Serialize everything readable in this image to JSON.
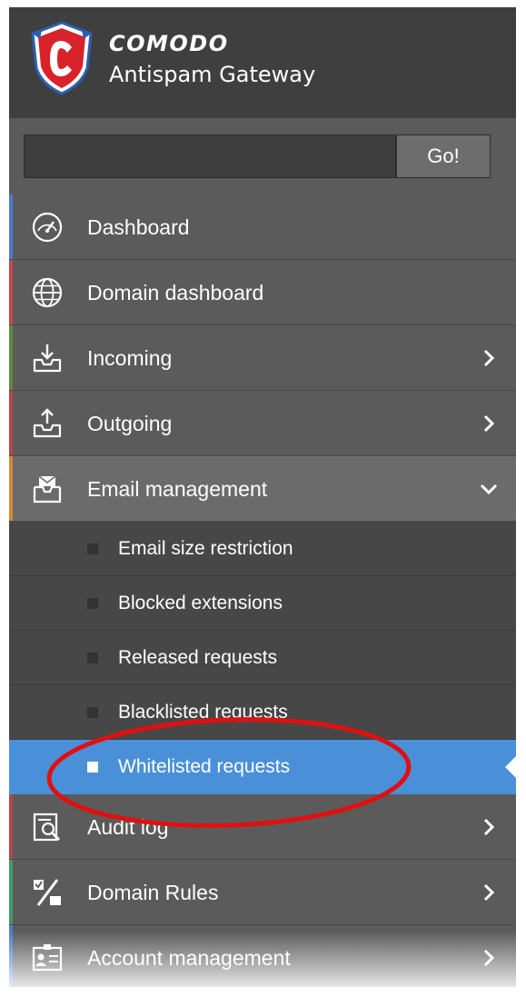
{
  "brand": {
    "name": "COMODO",
    "product": "Antispam Gateway"
  },
  "search": {
    "value": "",
    "go_label": "Go!"
  },
  "nav": {
    "items": [
      {
        "label": "Dashboard",
        "icon": "speedometer-icon",
        "stripe": "#4a7bd0"
      },
      {
        "label": "Domain dashboard",
        "icon": "globe-icon",
        "stripe": "#c9434d"
      },
      {
        "label": "Incoming",
        "icon": "inbox-download-icon",
        "stripe": "#5f8a3c"
      },
      {
        "label": "Outgoing",
        "icon": "inbox-upload-icon",
        "stripe": "#b8434b"
      },
      {
        "label": "Email management",
        "icon": "email-tray-icon",
        "stripe": "#d28b2f"
      },
      {
        "label": "Audit log",
        "icon": "audit-search-icon",
        "stripe": "#b8434b"
      },
      {
        "label": "Domain Rules",
        "icon": "domain-rules-icon",
        "stripe": "#3f9a6a"
      },
      {
        "label": "Account management",
        "icon": "account-card-icon",
        "stripe": "#4a7bd0"
      }
    ],
    "email_management_subitems": [
      {
        "label": "Email size restriction"
      },
      {
        "label": "Blocked extensions"
      },
      {
        "label": "Released requests"
      },
      {
        "label": "Blacklisted requests"
      },
      {
        "label": "Whitelisted requests"
      }
    ]
  },
  "colors": {
    "sidebar_bg": "#5b5b5b",
    "header_bg": "#3f3f3f",
    "active_bg": "#4a90d9",
    "highlight_ring": "#e01010"
  }
}
